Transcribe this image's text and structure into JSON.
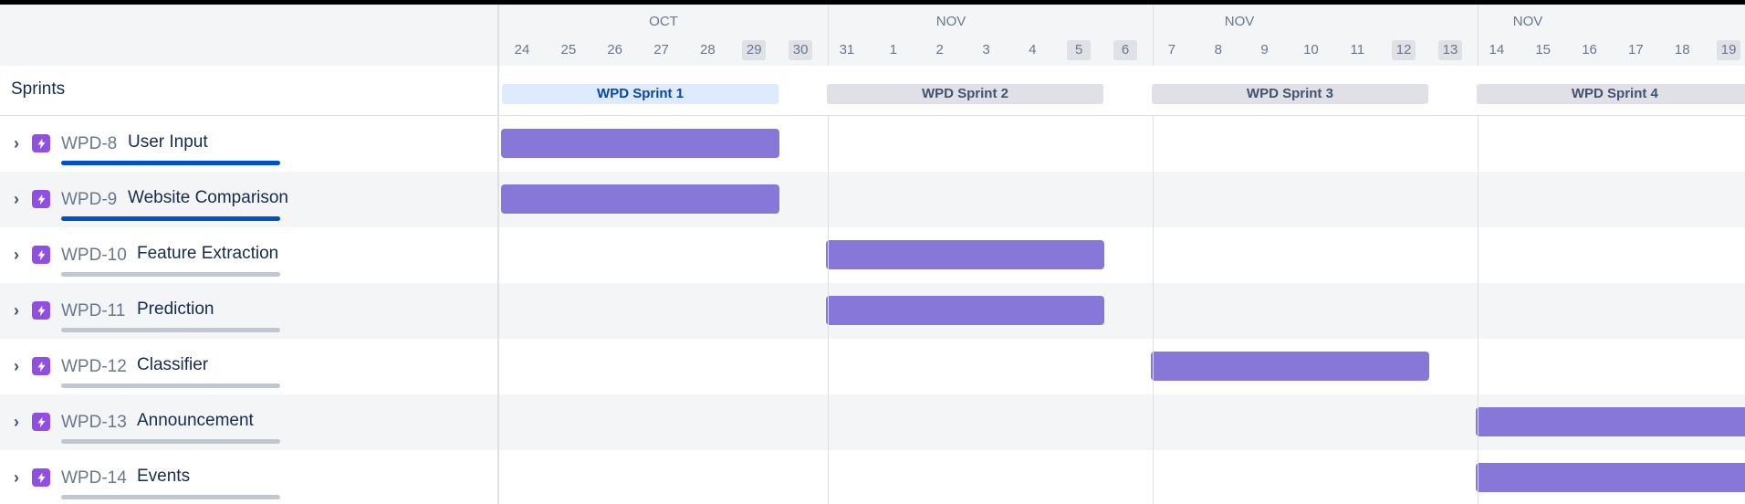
{
  "timeline": {
    "months": [
      "OCT",
      "NOV",
      "NOV",
      "NOV"
    ],
    "days": [
      "24",
      "25",
      "26",
      "27",
      "28",
      "29",
      "30",
      "31",
      "1",
      "2",
      "3",
      "4",
      "5",
      "6",
      "7",
      "8",
      "9",
      "10",
      "11",
      "12",
      "13",
      "14",
      "15",
      "16",
      "17",
      "18",
      "19"
    ],
    "weekend_days": [
      "29",
      "30",
      "5",
      "6",
      "12",
      "13",
      "19"
    ]
  },
  "sprints": {
    "label": "Sprints",
    "items": [
      "WPD Sprint 1",
      "WPD Sprint 2",
      "WPD Sprint 3",
      "WPD Sprint 4"
    ]
  },
  "issues": [
    {
      "key": "WPD-8",
      "title": "User Input",
      "progress": 1.0
    },
    {
      "key": "WPD-9",
      "title": "Website Comparison",
      "progress": 1.0
    },
    {
      "key": "WPD-10",
      "title": "Feature Extraction",
      "progress": 0.0
    },
    {
      "key": "WPD-11",
      "title": "Prediction",
      "progress": 0.0
    },
    {
      "key": "WPD-12",
      "title": "Classifier",
      "progress": 0.0
    },
    {
      "key": "WPD-13",
      "title": "Announcement",
      "progress": 0.0
    },
    {
      "key": "WPD-14",
      "title": "Events",
      "progress": 0.0
    }
  ],
  "icons": {
    "expander": "chevron-right-icon",
    "issue_type": "epic-lightning-icon"
  },
  "colors": {
    "bar": "#8777d9",
    "epic_icon": "#904ee2",
    "progress_done": "#0052cc",
    "progress_track": "#c1c7d0",
    "active_sprint_bg": "#deebff",
    "active_sprint_text": "#0747a6"
  }
}
